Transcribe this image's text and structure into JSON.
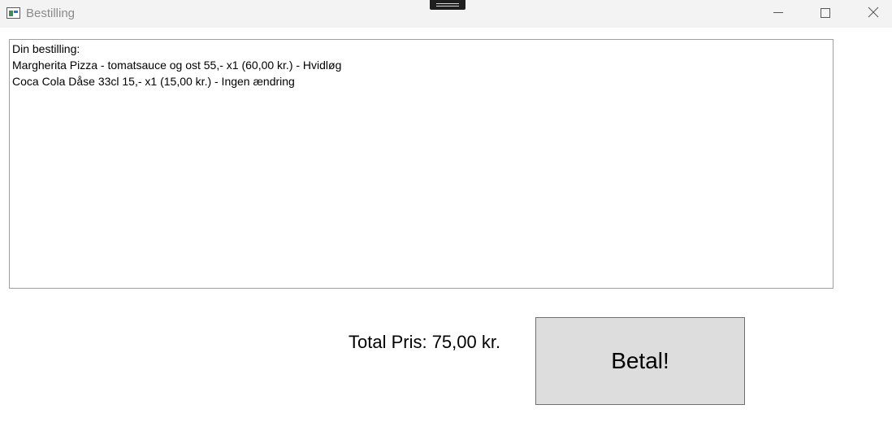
{
  "window": {
    "title": "Bestilling",
    "controls": [
      {
        "name": "minimize-icon"
      },
      {
        "name": "maximize-icon"
      },
      {
        "name": "close-icon"
      }
    ]
  },
  "order": {
    "heading": "Din bestilling:",
    "lines": [
      "Margherita Pizza - tomatsauce og ost 55,- x1 (60,00 kr.) - Hvidløg",
      "Coca Cola Dåse 33cl 15,- x1 (15,00 kr.) - Ingen ændring"
    ]
  },
  "total": {
    "label": "Total Pris: 75,00 kr."
  },
  "pay_button": {
    "label": "Betal!"
  }
}
